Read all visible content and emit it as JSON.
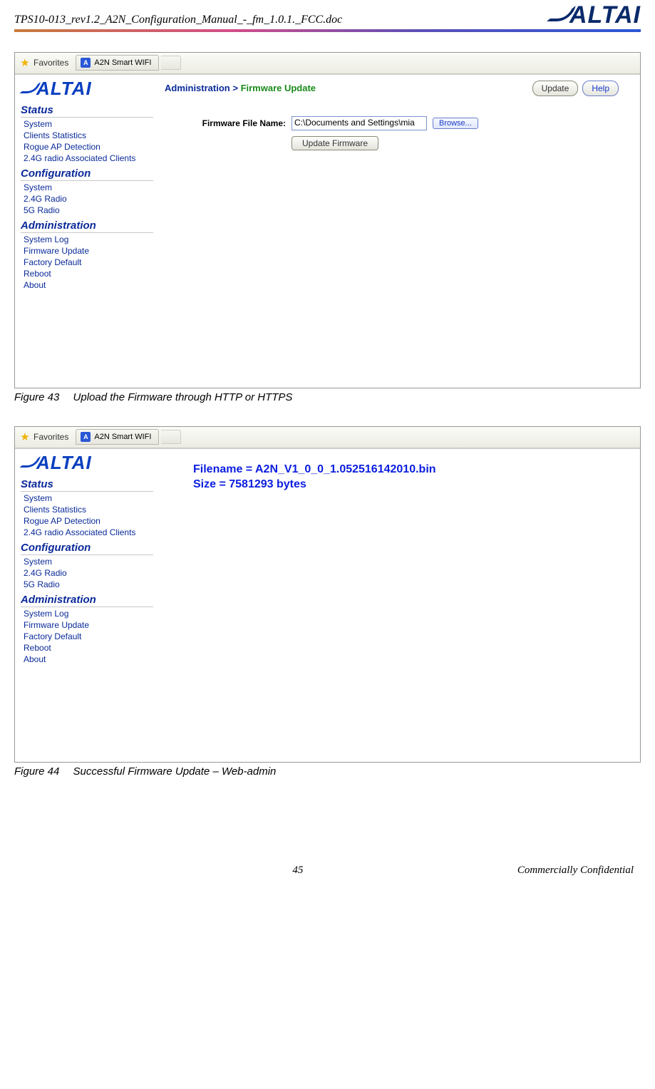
{
  "doc": {
    "header_filename": "TPS10-013_rev1.2_A2N_Configuration_Manual_-_fm_1.0.1._FCC.doc",
    "logo_text": "ALTAI",
    "page_number": "45",
    "footer_confidential": "Commercially Confidential"
  },
  "fig1": {
    "favorites_label": "Favorites",
    "tab_title": "A2N Smart WIFI",
    "sidebar_logo": "ALTAI",
    "nav": {
      "status_title": "Status",
      "status_items": [
        "System",
        "Clients Statistics",
        "Rogue AP Detection",
        "2.4G radio Associated Clients"
      ],
      "config_title": "Configuration",
      "config_items": [
        "System",
        "2.4G Radio",
        "5G Radio"
      ],
      "admin_title": "Administration",
      "admin_items": [
        "System Log",
        "Firmware Update",
        "Factory Default",
        "Reboot",
        "About"
      ]
    },
    "breadcrumb_admin": "Administration >",
    "breadcrumb_page": "Firmware Update",
    "btn_update": "Update",
    "btn_help": "Help",
    "label_filename": "Firmware File Name:",
    "input_value": "C:\\Documents and Settings\\mia",
    "btn_browse": "Browse...",
    "btn_update_fw": "Update Firmware",
    "caption": "Figure 43  Upload the Firmware through HTTP or HTTPS"
  },
  "fig2": {
    "favorites_label": "Favorites",
    "tab_title": "A2N Smart WIFI",
    "sidebar_logo": "ALTAI",
    "nav": {
      "status_title": "Status",
      "status_items": [
        "System",
        "Clients Statistics",
        "Rogue AP Detection",
        "2.4G radio Associated Clients"
      ],
      "config_title": "Configuration",
      "config_items": [
        "System",
        "2.4G Radio",
        "5G Radio"
      ],
      "admin_title": "Administration",
      "admin_items": [
        "System Log",
        "Firmware Update",
        "Factory Default",
        "Reboot",
        "About"
      ]
    },
    "result_line1": "Filename = A2N_V1_0_0_1.052516142010.bin",
    "result_line2": "Size = 7581293 bytes",
    "caption": "Figure 44  Successful Firmware Update – Web-admin"
  }
}
